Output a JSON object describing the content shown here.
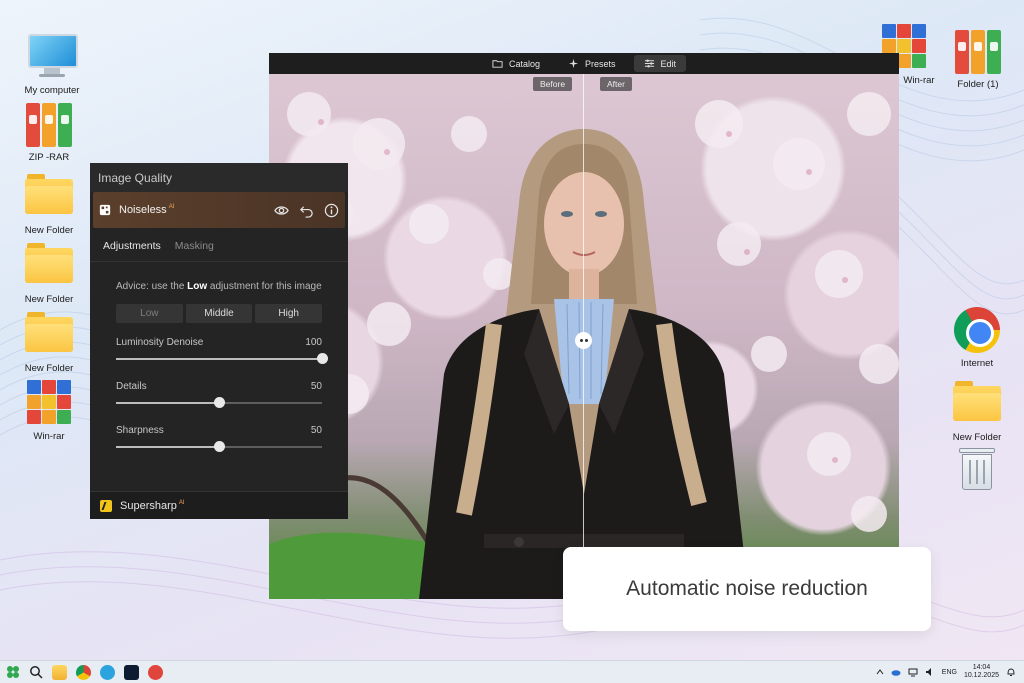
{
  "desktop": {
    "left_icons": [
      {
        "label": "My computer"
      },
      {
        "label": "ZIP -RAR"
      },
      {
        "label": "New Folder"
      },
      {
        "label": "New Folder"
      },
      {
        "label": "New Folder"
      },
      {
        "label": "Win-rar"
      }
    ],
    "right_icons": [
      {
        "label": "Win-rar"
      },
      {
        "label": "Folder (1)"
      },
      {
        "label": "Internet"
      },
      {
        "label": "New Folder"
      },
      {
        "label": "Recycle Bin"
      }
    ]
  },
  "app": {
    "nav": [
      {
        "label": "Catalog",
        "icon": "folder-icon"
      },
      {
        "label": "Presets",
        "icon": "sparkle-icon"
      },
      {
        "label": "Edit",
        "icon": "sliders-icon",
        "active": true
      }
    ],
    "compare": {
      "before": "Before",
      "after": "After"
    }
  },
  "panel": {
    "title": "Image Quality",
    "tool": {
      "name": "Noiseless",
      "ai_badge": "AI"
    },
    "tabs": [
      {
        "label": "Adjustments",
        "active": true
      },
      {
        "label": "Masking",
        "active": false
      }
    ],
    "advice": {
      "prefix": "Advice: use the ",
      "highlight": "Low",
      "suffix": " adjustment for this image"
    },
    "presets": [
      "Low",
      "Middle",
      "High"
    ],
    "sliders": [
      {
        "label": "Luminosity Denoise",
        "value": "100",
        "max": 100
      },
      {
        "label": "Details",
        "value": "50",
        "max": 100
      },
      {
        "label": "Sharpness",
        "value": "50",
        "max": 100
      }
    ],
    "next_tool": {
      "name": "Supersharp",
      "ai_badge": "AI"
    }
  },
  "callout": {
    "text": "Automatic noise reduction"
  },
  "taskbar": {
    "lang": "ENG",
    "time": "14:04",
    "date": "10.12.2025"
  },
  "colors": {
    "panel_bg": "#242424",
    "tool_header": "#5b3f2c",
    "accent_ai": "#f2a35e"
  }
}
